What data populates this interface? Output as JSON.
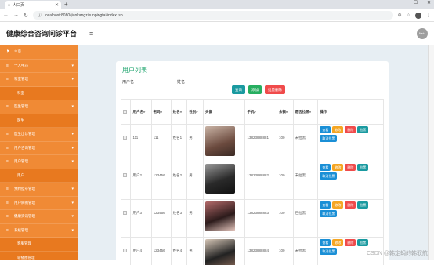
{
  "browser": {
    "tab_title": "人口页",
    "url": "localhost:8080/jiankangzixunpingtai/index.jsp"
  },
  "app": {
    "title": "健康综合咨询问诊平台",
    "user_avatar_text": "Nada"
  },
  "sidebar": {
    "items": [
      {
        "label": "主页",
        "sub": false,
        "arrow": ""
      },
      {
        "label": "个人中心",
        "sub": false,
        "arrow": "▾"
      },
      {
        "label": "科室管理",
        "sub": false,
        "arrow": "▾"
      },
      {
        "label": "科室",
        "sub": true,
        "arrow": ""
      },
      {
        "label": "医生管理",
        "sub": false,
        "arrow": "▾"
      },
      {
        "label": "医生",
        "sub": true,
        "arrow": ""
      },
      {
        "label": "医生出诊管理",
        "sub": false,
        "arrow": "▾"
      },
      {
        "label": "用户咨询管理",
        "sub": false,
        "arrow": "▾"
      },
      {
        "label": "用户管理",
        "sub": false,
        "arrow": "▾"
      },
      {
        "label": "用户",
        "sub": true,
        "arrow": ""
      },
      {
        "label": "预约挂号管理",
        "sub": false,
        "arrow": "▾"
      },
      {
        "label": "用户病例管理",
        "sub": false,
        "arrow": "▾"
      },
      {
        "label": "健康资讯管理",
        "sub": false,
        "arrow": "▾"
      },
      {
        "label": "系统管理",
        "sub": false,
        "arrow": "▾"
      },
      {
        "label": "客服管理",
        "sub": true,
        "arrow": ""
      },
      {
        "label": "轮播图管理",
        "sub": true,
        "arrow": ""
      }
    ]
  },
  "content": {
    "title": "用户列表",
    "search": {
      "username_label": "用户名",
      "name_label": "姓名",
      "query_button": "查询",
      "add_button": "添加",
      "batch_delete_button": "批量删除"
    },
    "table": {
      "headers": [
        "",
        "用户名#",
        "密码#",
        "姓名#",
        "性别#",
        "头像",
        "手机#",
        "余额#",
        "是否拉黑#",
        "操作"
      ],
      "rows": [
        {
          "username": "111",
          "password": "111",
          "name": "姓名1",
          "gender": "男",
          "phone": "13823888881",
          "balance": "100",
          "blacklisted": "未拉黑",
          "photo": "p1"
        },
        {
          "username": "用户2",
          "password": "123456",
          "name": "姓名2",
          "gender": "男",
          "phone": "13823888882",
          "balance": "100",
          "blacklisted": "未拉黑",
          "photo": "p2"
        },
        {
          "username": "用户3",
          "password": "123456",
          "name": "姓名3",
          "gender": "男",
          "phone": "13823888883",
          "balance": "100",
          "blacklisted": "已拉黑",
          "photo": "p3"
        },
        {
          "username": "用户4",
          "password": "123456",
          "name": "姓名4",
          "gender": "男",
          "phone": "13823888884",
          "balance": "100",
          "blacklisted": "未拉黑",
          "photo": "p4"
        }
      ],
      "ops": {
        "view": "查看",
        "edit": "修改",
        "delete": "删除",
        "blacklist": "拉黑",
        "unblacklist": "取消拉黑"
      }
    },
    "watermark": "CSDN @韩定蜎的韩驭航"
  },
  "colors": {
    "sidebar": "#f08a35",
    "title_green": "#1aa36b"
  }
}
